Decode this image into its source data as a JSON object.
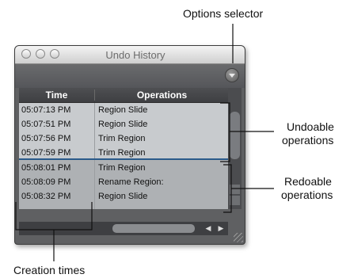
{
  "callouts": {
    "options_selector": "Options selector",
    "undoable_line1": "Undoable",
    "undoable_line2": "operations",
    "redoable_line1": "Redoable",
    "redoable_line2": "operations",
    "creation_times": "Creation times"
  },
  "window": {
    "title": "Undo History"
  },
  "columns": {
    "time": "Time",
    "operations": "Operations"
  },
  "rows": [
    {
      "time": "05:07:13 PM",
      "operation": "Region Slide"
    },
    {
      "time": "05:07:51 PM",
      "operation": "Region Slide"
    },
    {
      "time": "05:07:56 PM",
      "operation": "Trim Region"
    },
    {
      "time": "05:07:59 PM",
      "operation": "Trim Region"
    },
    {
      "time": "05:08:01 PM",
      "operation": "Trim Region"
    },
    {
      "time": "05:08:09 PM",
      "operation": "Rename Region:"
    },
    {
      "time": "05:08:32 PM",
      "operation": "Region Slide"
    }
  ],
  "colors": {
    "undoable_bg": "#c8cbce",
    "redoable_bg": "#aeb1b4",
    "marker": "#2a5a8a"
  },
  "icons": [
    "options-menu-icon",
    "scroll-left-icon",
    "scroll-right-icon",
    "resize-grip-icon"
  ]
}
